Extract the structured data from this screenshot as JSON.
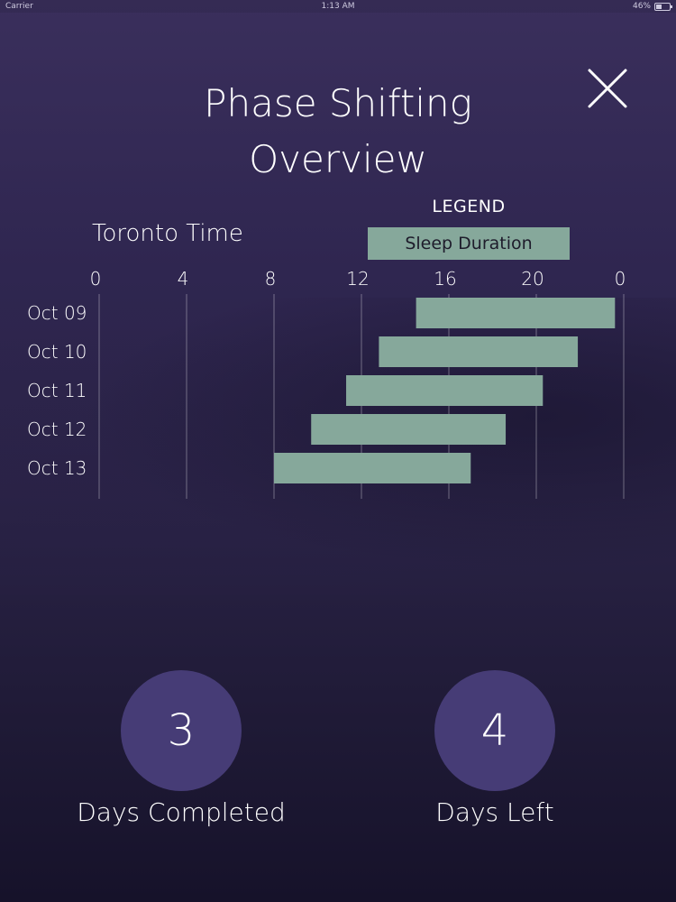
{
  "status_bar": {
    "carrier": "Carrier",
    "time": "1:13 AM",
    "battery": "46%",
    "battery_level": 0.46
  },
  "header": {
    "title_line1": "Phase Shifting",
    "title_line2": "Overview",
    "close_icon": "close-icon"
  },
  "chart_labels": {
    "timezone_label": "Toronto Time",
    "legend_title": "LEGEND",
    "legend_item": "Sleep Duration"
  },
  "colors": {
    "accent_bar": "#86a89b",
    "circle_fill": "#463c76",
    "background": "#2f2650"
  },
  "chart_data": {
    "type": "bar",
    "orientation": "horizontal-range",
    "title": "",
    "xlabel": "Toronto Time",
    "ylabel": "",
    "x_ticks": [
      "0",
      "4",
      "8",
      "12",
      "16",
      "20",
      "0"
    ],
    "xlim": [
      0,
      24
    ],
    "grid": true,
    "legend": {
      "position": "top-right",
      "entries": [
        "Sleep Duration"
      ]
    },
    "categories": [
      "Oct 09",
      "Oct 10",
      "Oct 11",
      "Oct 12",
      "Oct 13"
    ],
    "series": [
      {
        "name": "Sleep Duration",
        "ranges": [
          [
            14.5,
            23.6
          ],
          [
            12.8,
            21.9
          ],
          [
            11.3,
            20.3
          ],
          [
            9.7,
            18.6
          ],
          [
            8.0,
            17.0
          ]
        ]
      }
    ]
  },
  "progress": {
    "completed_value": "3",
    "completed_label": "Days Completed",
    "left_value": "4",
    "left_label": "Days Left"
  }
}
